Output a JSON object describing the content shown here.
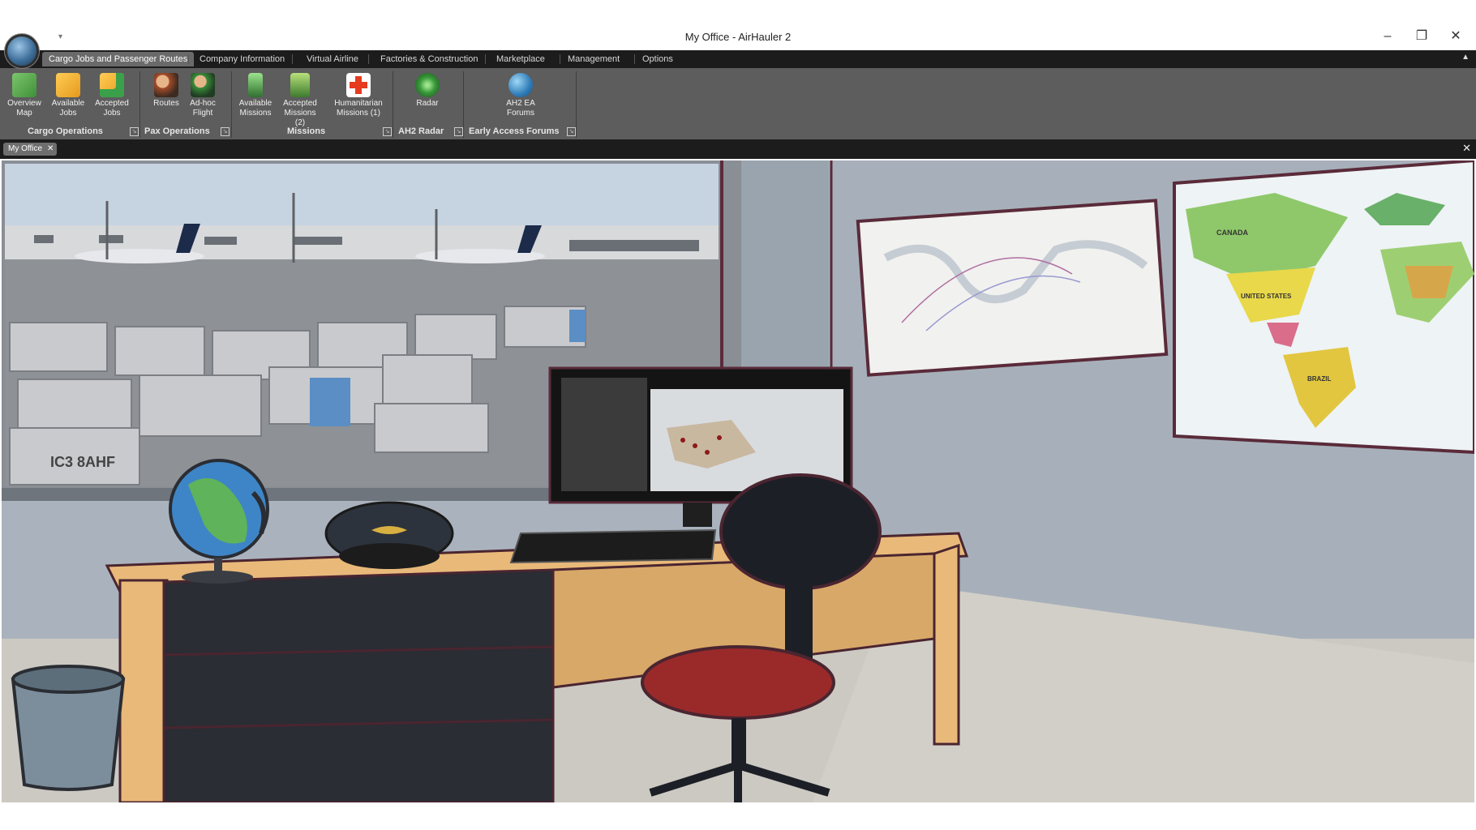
{
  "window": {
    "title": "My Office - AirHauler 2",
    "controls": {
      "minimize": "–",
      "maximize": "❐",
      "close": "✕"
    }
  },
  "menu": {
    "tabs": [
      {
        "label": "Cargo Jobs and Passenger Routes",
        "active": true
      },
      {
        "label": "Company Information"
      },
      {
        "label": "Virtual Airline"
      },
      {
        "label": "Factories & Construction"
      },
      {
        "label": "Marketplace"
      },
      {
        "label": "Management"
      },
      {
        "label": "Options"
      }
    ],
    "collapse_icon": "chevron-up-icon"
  },
  "ribbon": {
    "groups": [
      {
        "label": "Cargo Operations",
        "buttons": [
          {
            "label": "Overview Map",
            "icon": "map-pin-icon"
          },
          {
            "label": "Available Jobs",
            "icon": "cargo-box-icon"
          },
          {
            "label": "Accepted Jobs",
            "icon": "cargo-check-icon"
          }
        ]
      },
      {
        "label": "Pax Operations",
        "buttons": [
          {
            "label": "Routes",
            "icon": "passengers-icon"
          },
          {
            "label": "Ad-hoc Flight",
            "icon": "passenger-flight-icon"
          }
        ]
      },
      {
        "label": "Missions",
        "buttons": [
          {
            "label": "Available Missions",
            "icon": "phone-icon"
          },
          {
            "label": "Accepted Missions (2)",
            "icon": "mission-check-icon"
          },
          {
            "label": "Humanitarian Missions (1)",
            "icon": "red-cross-icon"
          }
        ]
      },
      {
        "label": "AH2 Radar",
        "buttons": [
          {
            "label": "Radar",
            "icon": "radar-icon"
          }
        ]
      },
      {
        "label": "Early Access Forums",
        "buttons": [
          {
            "label": "AH2 EA Forums",
            "icon": "globe-icon"
          }
        ]
      }
    ]
  },
  "document_tabs": [
    {
      "label": "My Office"
    }
  ],
  "office_scene": {
    "window_view": "airport apron with airliners and cargo containers",
    "wall_maps": [
      "route map",
      "political world map"
    ],
    "map_labels": [
      "CANADA",
      "UNITED STATES",
      "BRAZIL"
    ],
    "container_code": "IC3 8AHF",
    "colors": {
      "wall": "#aab3bd",
      "desk": "#e9b97a",
      "drawers": "#2a2d33",
      "chair_seat": "#9a2a2a"
    }
  }
}
